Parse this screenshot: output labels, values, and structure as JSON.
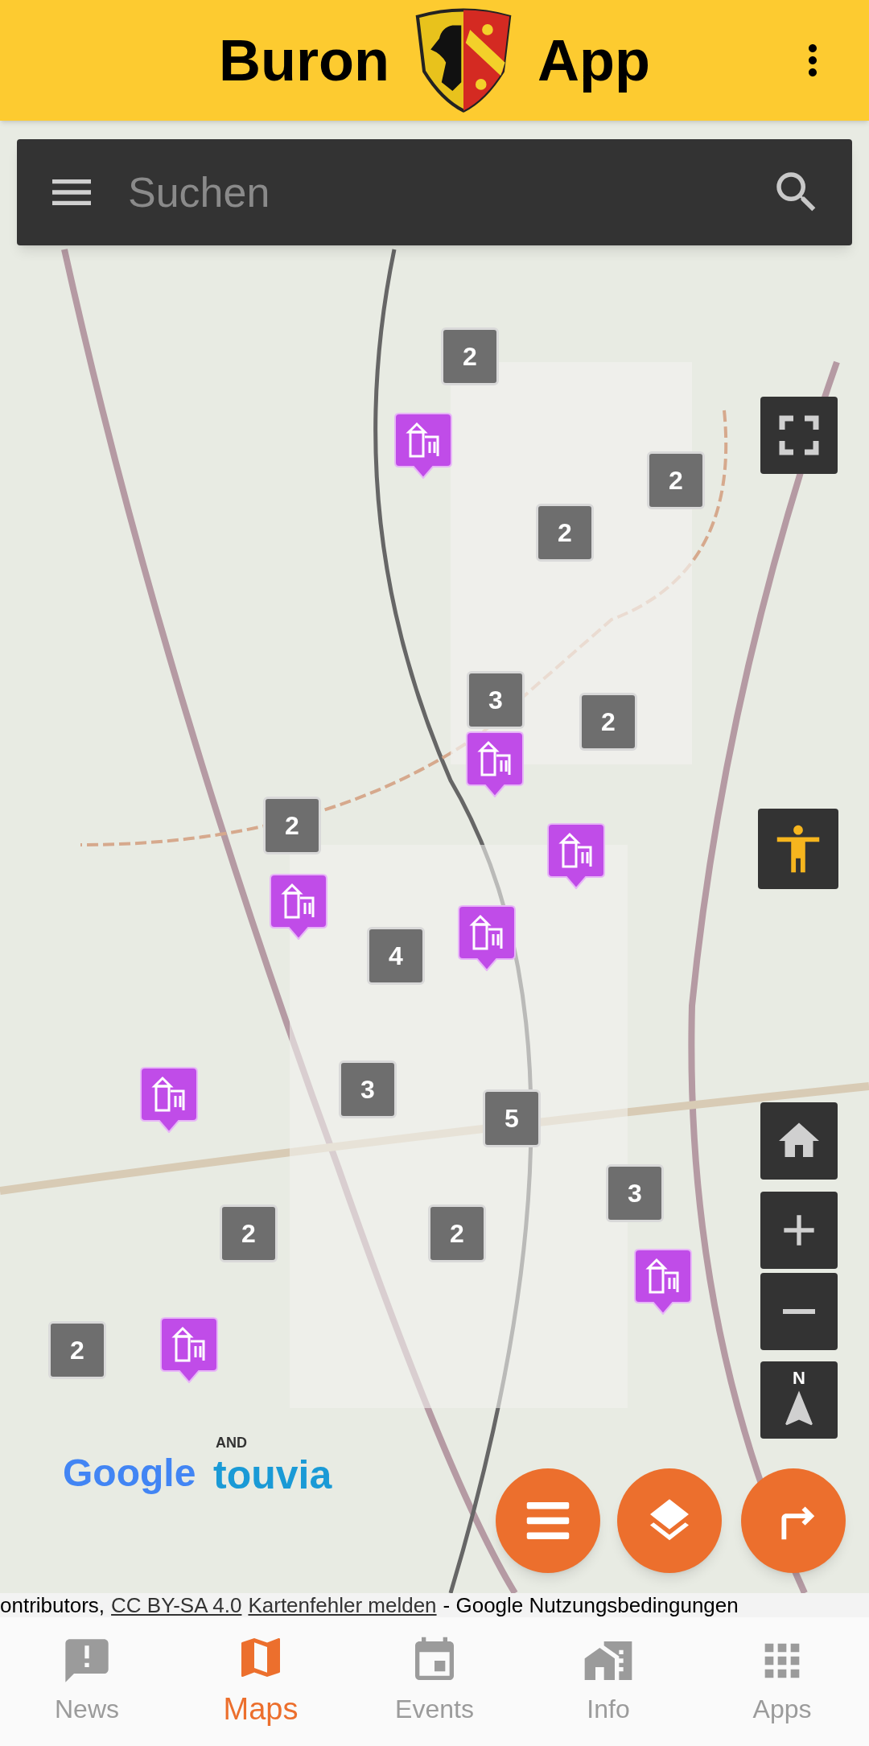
{
  "app_bar": {
    "title_left": "Buron",
    "title_right": "App"
  },
  "search": {
    "placeholder": "Suchen"
  },
  "map": {
    "clusters": [
      {
        "count": "2"
      },
      {
        "count": "2"
      },
      {
        "count": "2"
      },
      {
        "count": "3"
      },
      {
        "count": "2"
      },
      {
        "count": "2"
      },
      {
        "count": "4"
      },
      {
        "count": "3"
      },
      {
        "count": "5"
      },
      {
        "count": "3"
      },
      {
        "count": "2"
      },
      {
        "count": "2"
      },
      {
        "count": "2"
      }
    ],
    "compass_label": "N",
    "logos": {
      "google": "Google",
      "and": "AND",
      "touvia": "touvia"
    }
  },
  "attribution": {
    "prefix": "ontributors,",
    "license_link": "CC BY-SA 4.0",
    "report_link": "Kartenfehler melden",
    "suffix": "- Google Nutzungsbedingungen"
  },
  "nav": [
    {
      "label": "News",
      "selected": false
    },
    {
      "label": "Maps",
      "selected": true
    },
    {
      "label": "Events",
      "selected": false
    },
    {
      "label": "Info",
      "selected": false
    },
    {
      "label": "Apps",
      "selected": false
    }
  ]
}
